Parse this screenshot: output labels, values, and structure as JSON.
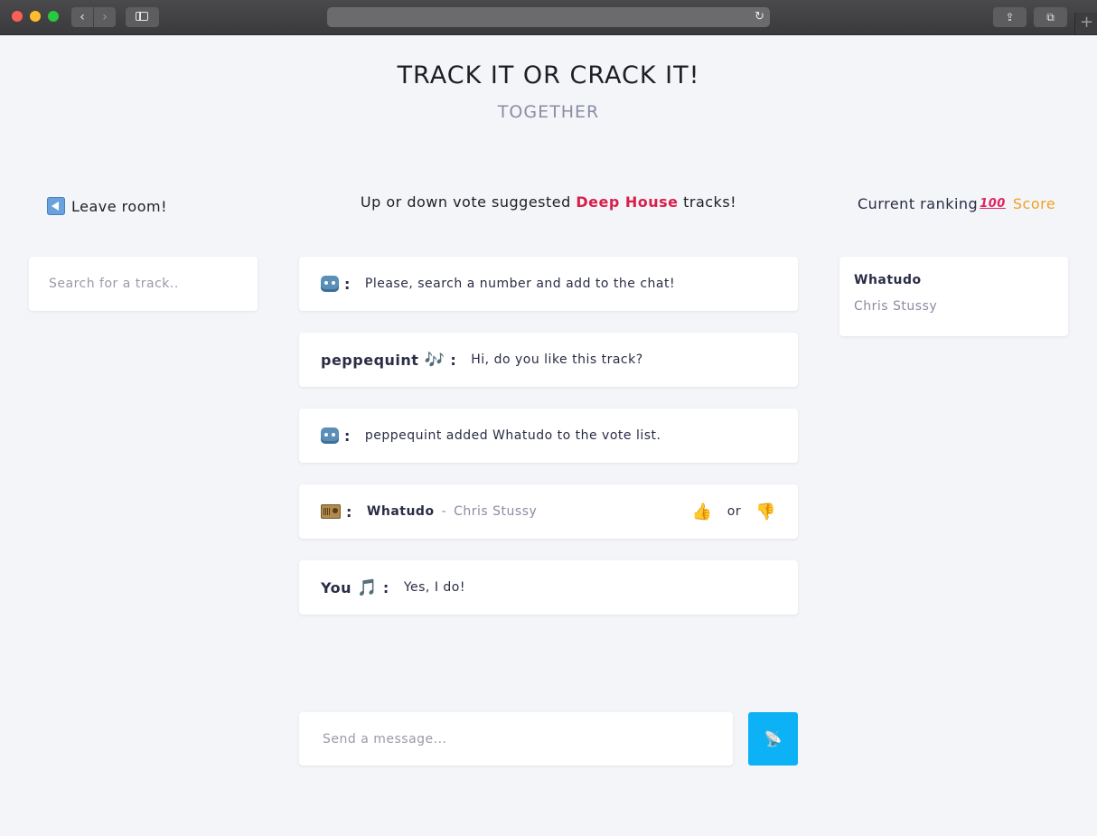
{
  "app": {
    "title": "TRACK IT OR CRACK IT!",
    "subtitle": "TOGETHER"
  },
  "browser": {
    "back_icon": "‹",
    "forward_icon": "›",
    "reload_icon": "↻",
    "share_icon": "⇪",
    "tabs_icon": "⧉",
    "newtab_icon": "+"
  },
  "left": {
    "leave_label": "Leave room!",
    "search_placeholder": "Search for a track.."
  },
  "center": {
    "heading_prefix": "Up or down vote suggested ",
    "genre": "Deep House",
    "heading_suffix": " tracks!",
    "messages": [
      {
        "icon": "robot-icon",
        "text": "Please, search a number and add to the chat!"
      },
      {
        "sender": "peppequint",
        "emoji": "🎶",
        "text": "Hi, do you like this track?"
      },
      {
        "icon": "robot-icon",
        "text": "peppequint added Whatudo to the vote list."
      },
      {
        "icon": "radio-icon",
        "track": "Whatudo",
        "separator": "-",
        "artist": "Chris Stussy",
        "up": "👍",
        "or": "or",
        "down": "👎"
      },
      {
        "sender": "You",
        "emoji": "🎵",
        "text": "Yes, I do!"
      }
    ],
    "colon": ":",
    "message_placeholder": "Send a message...",
    "send_icon": "📡"
  },
  "right": {
    "ranking_label": "Current ranking",
    "hundred_icon": "100",
    "score_label": "Score",
    "ranking": [
      {
        "track": "Whatudo",
        "artist": "Chris Stussy"
      }
    ]
  },
  "colors": {
    "accent_genre": "#d81f4a",
    "score": "#f0a020",
    "send_button": "#0cb2f5",
    "background": "#f4f5f9"
  }
}
